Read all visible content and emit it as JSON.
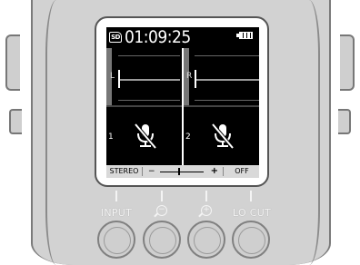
{
  "status": {
    "media_badge": "SD",
    "time": "01:09:25"
  },
  "meters": {
    "left_label": "L",
    "right_label": "R"
  },
  "inputs": {
    "ch1_label": "1",
    "ch2_label": "2",
    "ch1_icon": "mic-muted-icon",
    "ch2_icon": "mic-muted-icon"
  },
  "bottom_bar": {
    "stereo_label": "STEREO",
    "gain_minus": "−",
    "gain_plus": "+",
    "lo_cut_value": "OFF"
  },
  "hardware_buttons": {
    "input_label": "INPUT",
    "minus_label": "−",
    "plus_label": "+",
    "lo_cut_label": "LO CUT"
  }
}
